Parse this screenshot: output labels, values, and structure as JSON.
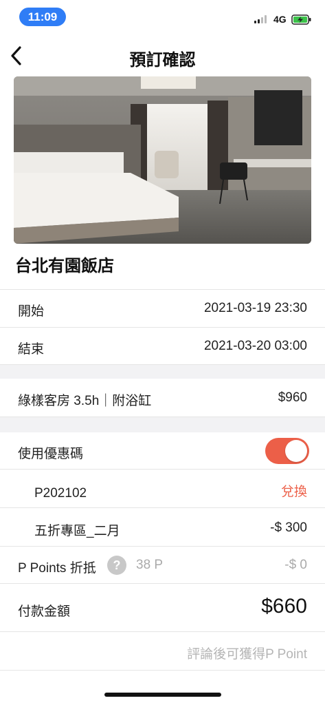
{
  "status_bar": {
    "time": "11:09",
    "network": "4G"
  },
  "nav": {
    "title": "預訂確認"
  },
  "hotel": {
    "name": "台北有園飯店"
  },
  "booking": {
    "start_label": "開始",
    "start_value": "2021-03-19 23:30",
    "end_label": "結束",
    "end_value": "2021-03-20 03:00"
  },
  "room": {
    "name": "綠樣客房 3.5h｜附浴缸",
    "price": "$960"
  },
  "coupon": {
    "toggle_label": "使用優惠碼",
    "toggle_on": true,
    "code": "P202102",
    "redeem_label": "兌換",
    "discount_name": "五折專區_二月",
    "discount_value": "-$ 300"
  },
  "points": {
    "label": "P Points 折抵",
    "help_symbol": "?",
    "balance": "38 P",
    "deduction": "-$ 0"
  },
  "payment": {
    "label": "付款金額",
    "amount": "$660"
  },
  "note": "評論後可獲得P Point",
  "colors": {
    "accent": "#ec5f48",
    "status_pill": "#2f7df6",
    "battery_fill": "#3cc34a"
  }
}
